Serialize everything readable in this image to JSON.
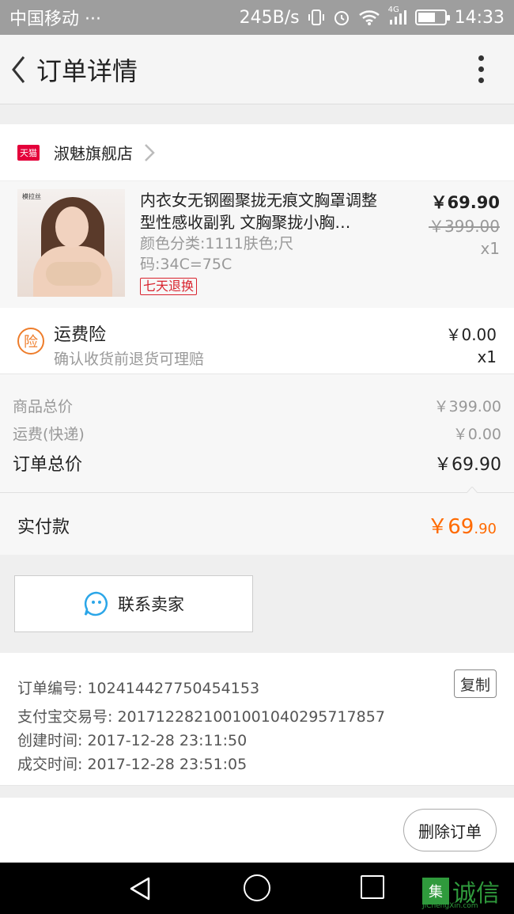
{
  "status_bar": {
    "carrier": "中国移动 ···",
    "net_speed": "245B/s",
    "network": "4G",
    "time": "14:33"
  },
  "header": {
    "title": "订单详情",
    "back_icon": "chevron-left-icon",
    "more_icon": "vertical-dots-icon"
  },
  "shop": {
    "badge": "天猫",
    "name": "淑魅旗舰店"
  },
  "product": {
    "image_brand": "模拉丝",
    "title": "内衣女无钢圈聚拢无痕文胸罩调整型性感收副乳 文胸聚拢小胸…",
    "spec": "颜色分类:1111肤色;尺码:34C=75C",
    "tag": "七天退换",
    "price": "￥69.90",
    "original_price": "￥399.00",
    "quantity": "x1"
  },
  "insurance": {
    "icon_text": "险",
    "name": "运费险",
    "desc": "确认收货前退货可理赔",
    "price": "￥0.00",
    "quantity": "x1"
  },
  "summary": {
    "goods_label": "商品总价",
    "goods_value": "￥399.00",
    "shipping_label": "运费(快递)",
    "shipping_value": "￥0.00",
    "total_label": "订单总价",
    "total_value": "￥69.90"
  },
  "payment": {
    "label": "实付款",
    "value_main": "￥69",
    "value_decimal": ".90",
    "accent_color": "#ff6a00"
  },
  "contact": {
    "label": "联系卖家",
    "icon": "chat-face-icon"
  },
  "order_info": {
    "order_no": "订单编号: 102414427750454153",
    "alipay_no": "支付宝交易号: 2017122821001001040295717857",
    "created": "创建时间: 2017-12-28 23:11:50",
    "completed": "成交时间: 2017-12-28 23:51:05",
    "copy_label": "复制"
  },
  "actions": {
    "delete_label": "删除订单"
  },
  "watermark": {
    "box_char": "集",
    "text": "诚信",
    "url": "JiChengXin.com"
  }
}
